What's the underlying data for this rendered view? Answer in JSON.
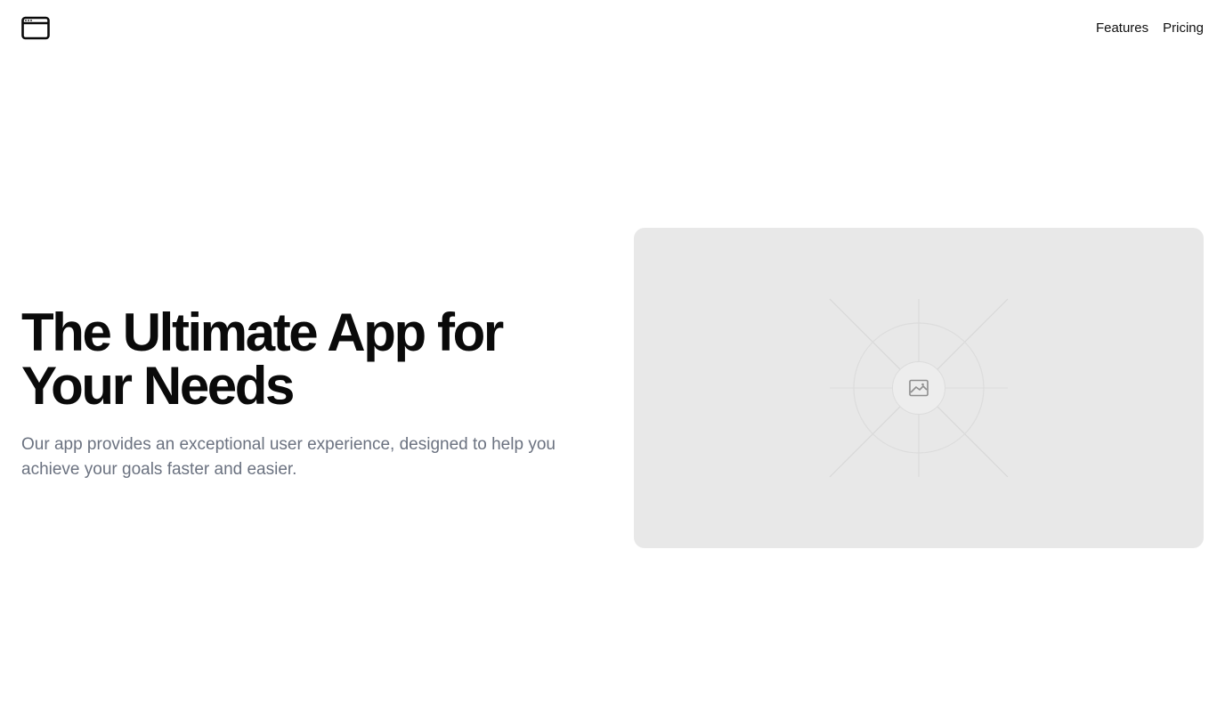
{
  "header": {
    "logo_icon": "browser-window-icon",
    "nav": {
      "features": "Features",
      "pricing": "Pricing"
    }
  },
  "hero": {
    "title_line1": "The Ultimate App for",
    "title_line2": "Your Needs",
    "subtitle": "Our app provides an exceptional user experience, designed to help you achieve your goals faster and easier."
  },
  "media": {
    "placeholder_icon": "image-icon"
  },
  "colors": {
    "text_primary": "#0a0a0a",
    "text_muted": "#6b7280",
    "placeholder_bg": "#e8e8e8"
  }
}
